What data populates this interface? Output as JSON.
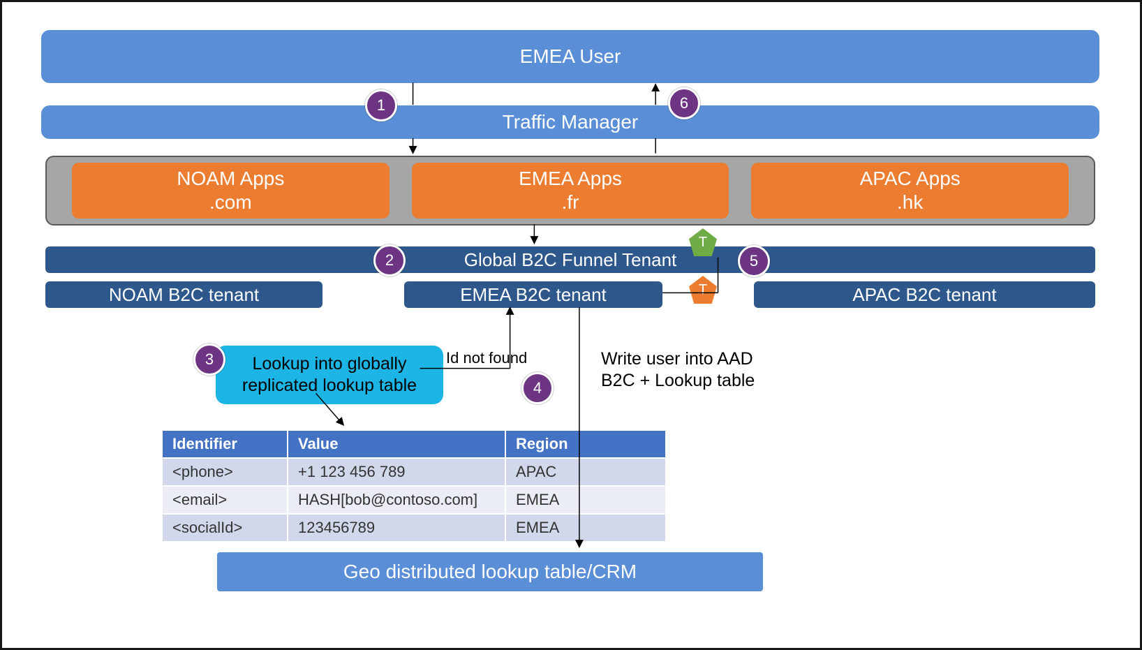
{
  "bars": {
    "user": "EMEA User",
    "traffic_manager": "Traffic Manager",
    "apps": [
      {
        "line1": "NOAM Apps",
        "line2": ".com"
      },
      {
        "line1": "EMEA Apps",
        "line2": ".fr"
      },
      {
        "line1": "APAC Apps",
        "line2": ".hk"
      }
    ],
    "funnel": "Global B2C Funnel Tenant",
    "tenants": {
      "noam": "NOAM B2C tenant",
      "emea": "EMEA B2C tenant",
      "apac": "APAC B2C tenant"
    },
    "geo": "Geo distributed lookup table/CRM"
  },
  "lookup_box": "Lookup into globally\nreplicated lookup table",
  "annotations": {
    "id_not_found": "Id not found",
    "write_user": "Write user into AAD\nB2C + Lookup table"
  },
  "tokens": {
    "t1": "T",
    "t2": "T"
  },
  "steps": {
    "s1": "1",
    "s2": "2",
    "s3": "3",
    "s4": "4",
    "s5": "5",
    "s6": "6"
  },
  "table": {
    "headers": [
      "Identifier",
      "Value",
      "Region"
    ],
    "rows": [
      {
        "id": "<phone>",
        "val": "+1 123 456 789",
        "region": "APAC"
      },
      {
        "id": "<email>",
        "val": "HASH[bob@contoso.com]",
        "region": "EMEA"
      },
      {
        "id": "<socialId>",
        "val": "123456789",
        "region": "EMEA"
      }
    ]
  }
}
